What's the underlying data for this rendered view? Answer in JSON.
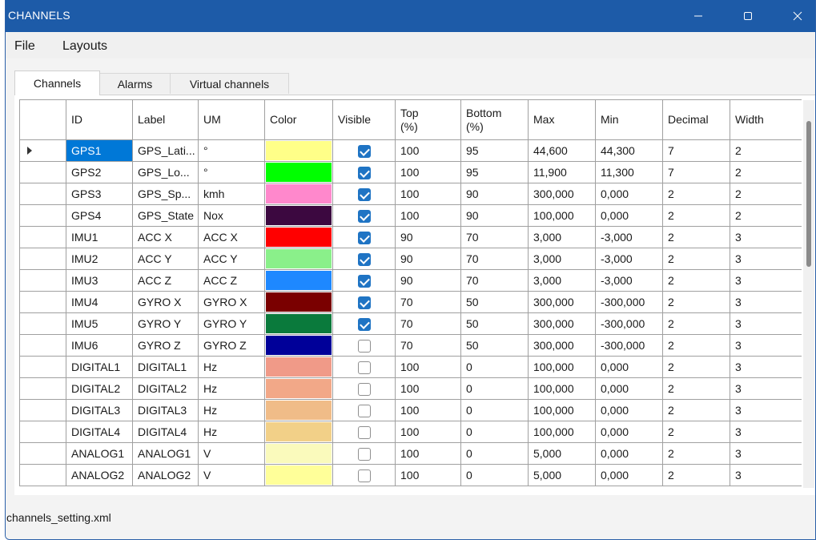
{
  "window": {
    "title": "CHANNELS",
    "title_bar_color": "#1d5ba8"
  },
  "menu": {
    "file": "File",
    "layouts": "Layouts"
  },
  "tabs": [
    {
      "label": "Channels",
      "active": true
    },
    {
      "label": "Alarms",
      "active": false
    },
    {
      "label": "Virtual channels",
      "active": false
    }
  ],
  "grid": {
    "headers": {
      "id": "ID",
      "label": "Label",
      "um": "UM",
      "color": "Color",
      "visible": "Visible",
      "top_line1": "Top",
      "top_line2": "(%)",
      "bottom_line1": "Bottom",
      "bottom_line2": "(%)",
      "max": "Max",
      "min": "Min",
      "decimal": "Decimal",
      "width": "Width"
    },
    "rows": [
      {
        "id": "GPS1",
        "label": "GPS_Lati...",
        "um": "°",
        "color": "#ffff88",
        "visible": true,
        "top": "100",
        "bottom": "95",
        "max": "44,600",
        "min": "44,300",
        "decimal": "7",
        "width": "2",
        "selected": true
      },
      {
        "id": "GPS2",
        "label": "GPS_Lo...",
        "um": "°",
        "color": "#00ff00",
        "visible": true,
        "top": "100",
        "bottom": "95",
        "max": "11,900",
        "min": "11,300",
        "decimal": "7",
        "width": "2"
      },
      {
        "id": "GPS3",
        "label": "GPS_Sp...",
        "um": "kmh",
        "color": "#ff88cc",
        "visible": true,
        "top": "100",
        "bottom": "90",
        "max": "300,000",
        "min": "0,000",
        "decimal": "2",
        "width": "2"
      },
      {
        "id": "GPS4",
        "label": "GPS_State",
        "um": "Nox",
        "color": "#3c0840",
        "visible": true,
        "top": "100",
        "bottom": "90",
        "max": "100,000",
        "min": "0,000",
        "decimal": "2",
        "width": "2"
      },
      {
        "id": "IMU1",
        "label": "ACC X",
        "um": "ACC X",
        "color": "#ff0000",
        "visible": true,
        "top": "90",
        "bottom": "70",
        "max": "3,000",
        "min": "-3,000",
        "decimal": "2",
        "width": "3"
      },
      {
        "id": "IMU2",
        "label": "ACC Y",
        "um": "ACC Y",
        "color": "#8af08a",
        "visible": true,
        "top": "90",
        "bottom": "70",
        "max": "3,000",
        "min": "-3,000",
        "decimal": "2",
        "width": "3"
      },
      {
        "id": "IMU3",
        "label": "ACC Z",
        "um": "ACC Z",
        "color": "#1e88ff",
        "visible": true,
        "top": "90",
        "bottom": "70",
        "max": "3,000",
        "min": "-3,000",
        "decimal": "2",
        "width": "3"
      },
      {
        "id": "IMU4",
        "label": "GYRO X",
        "um": "GYRO X",
        "color": "#7a0000",
        "visible": true,
        "top": "70",
        "bottom": "50",
        "max": "300,000",
        "min": "-300,000",
        "decimal": "2",
        "width": "3"
      },
      {
        "id": "IMU5",
        "label": "GYRO Y",
        "um": "GYRO Y",
        "color": "#0a7a3c",
        "visible": true,
        "top": "70",
        "bottom": "50",
        "max": "300,000",
        "min": "-300,000",
        "decimal": "2",
        "width": "3"
      },
      {
        "id": "IMU6",
        "label": "GYRO Z",
        "um": "GYRO Z",
        "color": "#000099",
        "visible": false,
        "top": "70",
        "bottom": "50",
        "max": "300,000",
        "min": "-300,000",
        "decimal": "2",
        "width": "3"
      },
      {
        "id": "DIGITAL1",
        "label": "DIGITAL1",
        "um": "Hz",
        "color": "#f09a88",
        "visible": false,
        "top": "100",
        "bottom": "0",
        "max": "100,000",
        "min": "0,000",
        "decimal": "2",
        "width": "3"
      },
      {
        "id": "DIGITAL2",
        "label": "DIGITAL2",
        "um": "Hz",
        "color": "#f2a888",
        "visible": false,
        "top": "100",
        "bottom": "0",
        "max": "100,000",
        "min": "0,000",
        "decimal": "2",
        "width": "3"
      },
      {
        "id": "DIGITAL3",
        "label": "DIGITAL3",
        "um": "Hz",
        "color": "#f0bc88",
        "visible": false,
        "top": "100",
        "bottom": "0",
        "max": "100,000",
        "min": "0,000",
        "decimal": "2",
        "width": "3"
      },
      {
        "id": "DIGITAL4",
        "label": "DIGITAL4",
        "um": "Hz",
        "color": "#f2d088",
        "visible": false,
        "top": "100",
        "bottom": "0",
        "max": "100,000",
        "min": "0,000",
        "decimal": "2",
        "width": "3"
      },
      {
        "id": "ANALOG1",
        "label": "ANALOG1",
        "um": "V",
        "color": "#fafabc",
        "visible": false,
        "top": "100",
        "bottom": "0",
        "max": "5,000",
        "min": "0,000",
        "decimal": "2",
        "width": "3"
      },
      {
        "id": "ANALOG2",
        "label": "ANALOG2",
        "um": "V",
        "color": "#ffff99",
        "visible": false,
        "top": "100",
        "bottom": "0",
        "max": "5,000",
        "min": "0,000",
        "decimal": "2",
        "width": "3"
      }
    ]
  },
  "status": {
    "filename": "channels_setting.xml"
  },
  "icons": {
    "minimize": "minimize-icon",
    "maximize": "maximize-icon",
    "close": "close-icon",
    "current_row": "row-pointer-icon"
  }
}
